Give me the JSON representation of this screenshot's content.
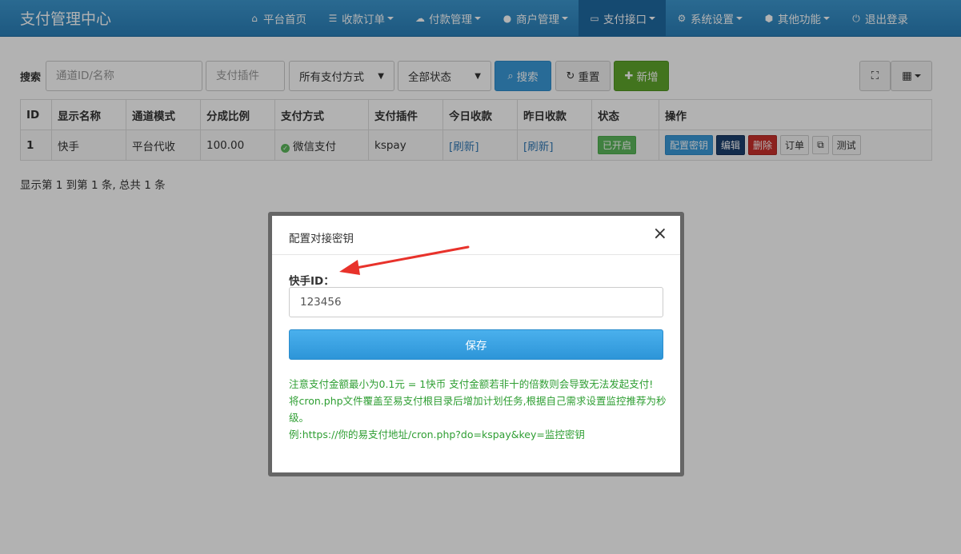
{
  "navbar": {
    "brand": "支付管理中心",
    "items": [
      {
        "icon": "home-icon",
        "glyph": "⌂",
        "label": "平台首页",
        "dropdown": false
      },
      {
        "icon": "list-icon",
        "glyph": "☰",
        "label": "收款订单",
        "dropdown": true
      },
      {
        "icon": "cloud-icon",
        "glyph": "☁",
        "label": "付款管理",
        "dropdown": true
      },
      {
        "icon": "user-icon",
        "glyph": "👤",
        "label": "商户管理",
        "dropdown": true
      },
      {
        "icon": "card-icon",
        "glyph": "▭",
        "label": "支付接口",
        "dropdown": true,
        "active": true
      },
      {
        "icon": "gear-icon",
        "glyph": "⚙",
        "label": "系统设置",
        "dropdown": true
      },
      {
        "icon": "cube-icon",
        "glyph": "⬢",
        "label": "其他功能",
        "dropdown": true
      },
      {
        "icon": "power-icon",
        "glyph": "⏻",
        "label": "退出登录",
        "dropdown": false
      }
    ]
  },
  "search": {
    "label": "搜索",
    "channel_placeholder": "通道ID/名称",
    "plugin_placeholder": "支付插件",
    "method_select": "所有支付方式",
    "status_select": "全部状态",
    "search_label": "搜索",
    "reset_label": "重置",
    "add_label": "新增"
  },
  "table": {
    "headers": [
      "ID",
      "显示名称",
      "通道模式",
      "分成比例",
      "支付方式",
      "支付插件",
      "今日收款",
      "昨日收款",
      "状态",
      "操作"
    ],
    "rows": [
      {
        "id": "1",
        "name": "快手",
        "mode": "平台代收",
        "ratio": "100.00",
        "method": "微信支付",
        "plugin": "kspay",
        "today": "[刷新]",
        "yesterday": "[刷新]",
        "status": "已开启",
        "ops": {
          "config": "配置密钥",
          "edit": "编辑",
          "delete": "删除",
          "orders": "订单",
          "test": "测试"
        }
      }
    ]
  },
  "summary": "显示第 1 到第 1 条, 总共 1 条",
  "modal": {
    "title": "配置对接密钥",
    "field_label": "快手ID：",
    "field_value": "123456",
    "save_label": "保存",
    "notes": [
      "注意支付金额最小为0.1元 = 1快币 支付金额若非十的倍数则会导致无法发起支付!",
      "将cron.php文件覆盖至易支付根目录后增加计划任务,根据自己需求设置监控推荐为秒级。",
      "例:https://你的易支付地址/cron.php?do=kspay&key=监控密钥"
    ]
  },
  "colors": {
    "navbar": "#2a7fb8",
    "primary": "#3a9ad9",
    "success": "#5fa62b",
    "danger": "#c9302c",
    "note_text": "#2e9e32",
    "annotation_arrow": "#e8322b"
  }
}
